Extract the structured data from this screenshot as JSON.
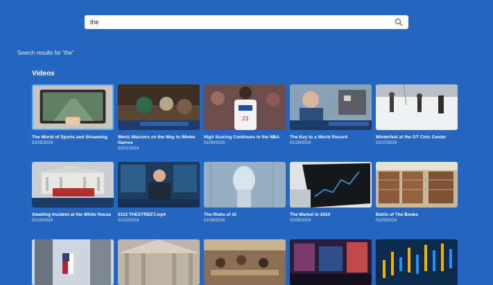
{
  "search": {
    "query": "the"
  },
  "results_label": "Search results for \"the\"",
  "section_title": "Videos",
  "videos": [
    {
      "title": "The World of Sports and Streaming",
      "date": "02/05/2024"
    },
    {
      "title": "Wertz Warriors on the Way to Winter Games",
      "date": "02/01/2024"
    },
    {
      "title": "High Scoring Continues in the NBA",
      "date": "01/30/2024"
    },
    {
      "title": "The Key to a World Record",
      "date": "01/28/2024"
    },
    {
      "title": "Winterfest at the GT Civic Center",
      "date": "01/27/2024"
    },
    {
      "title": "Swatting Incident at the White House",
      "date": "01/15/2024"
    },
    {
      "title": "0112 THESTREET.mp4",
      "date": "01/12/2024"
    },
    {
      "title": "The Risks of AI",
      "date": "01/09/2024"
    },
    {
      "title": "The Market in 2024",
      "date": "01/05/2024"
    },
    {
      "title": "Battle of The Books",
      "date": "01/03/2024"
    }
  ]
}
